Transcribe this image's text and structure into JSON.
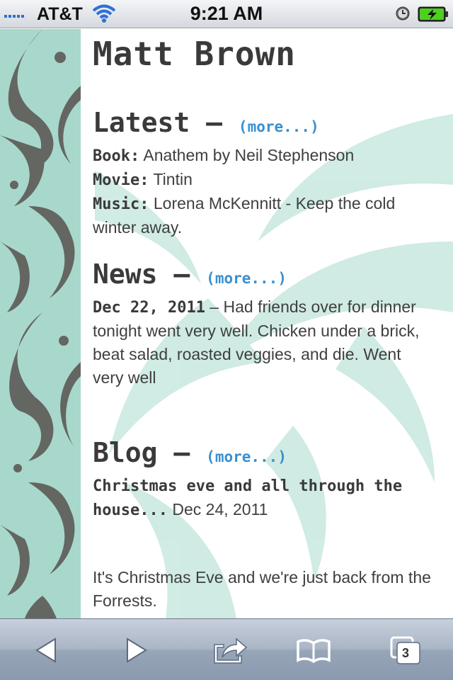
{
  "status_bar": {
    "carrier": "AT&T",
    "time": "9:21 AM"
  },
  "page": {
    "title": "Matt Brown",
    "latest": {
      "heading": "Latest –",
      "more": "(more...)",
      "items": [
        {
          "label": "Book:",
          "value": "Anathem by Neil Stephenson"
        },
        {
          "label": "Movie:",
          "value": "Tintin"
        },
        {
          "label": "Music:",
          "value": "Lorena McKennitt - Keep the cold winter away."
        }
      ]
    },
    "news": {
      "heading": "News –",
      "more": "(more...)",
      "date": "Dec 22, 2011",
      "dash": " – ",
      "text": "Had friends over for dinner tonight went very well. Chicken under a brick, beat salad, roasted veggies, and die. Went very well"
    },
    "blog": {
      "heading": "Blog –",
      "more": "(more...)",
      "post_title": "Christmas eve and all through the house...",
      "post_date": "Dec 24, 2011",
      "excerpt": "It's Christmas Eve and we're just back from the Forrests."
    }
  },
  "toolbar": {
    "tabs_count": "3",
    "icons": [
      "back-icon",
      "forward-icon",
      "share-icon",
      "bookmarks-icon",
      "tabs-icon"
    ]
  },
  "colors": {
    "sidebar": "#a8d8cb",
    "link": "#3a8fd0",
    "text": "#3f3f3f"
  }
}
